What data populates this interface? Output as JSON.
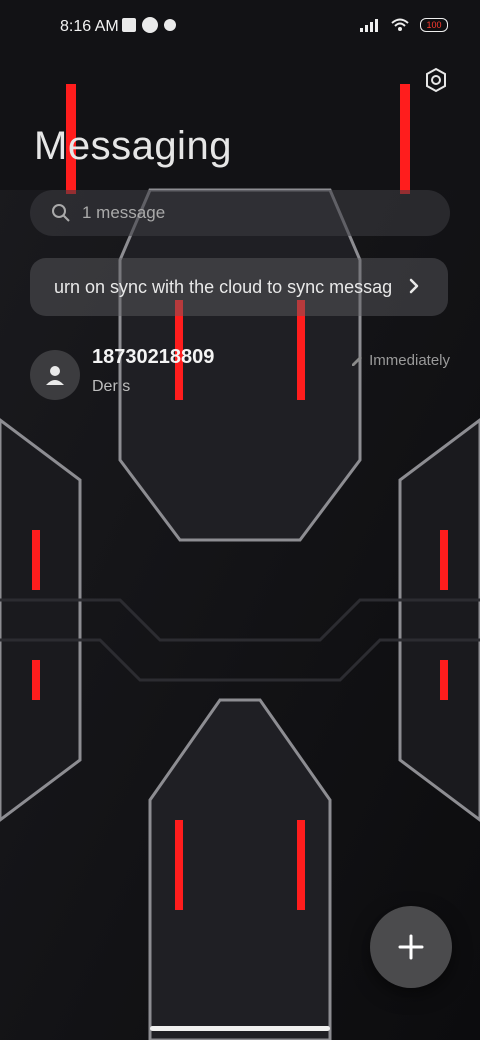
{
  "status_bar": {
    "time": "8:16 AM",
    "battery": "100"
  },
  "header": {
    "title": "Messaging",
    "settings_icon": "gear-icon"
  },
  "search": {
    "placeholder": "1 message",
    "icon": "search-icon"
  },
  "sync_banner": {
    "text": "urn on sync with the cloud to sync messag",
    "chevron_icon": "chevron-right-icon"
  },
  "conversations": [
    {
      "contact": "18730218809",
      "snippet": "Der s",
      "time": "Immediately"
    }
  ],
  "fab": {
    "icon": "plus-icon"
  },
  "colors": {
    "accent_red": "#ff1d1d",
    "background": "#0b0b0d"
  }
}
